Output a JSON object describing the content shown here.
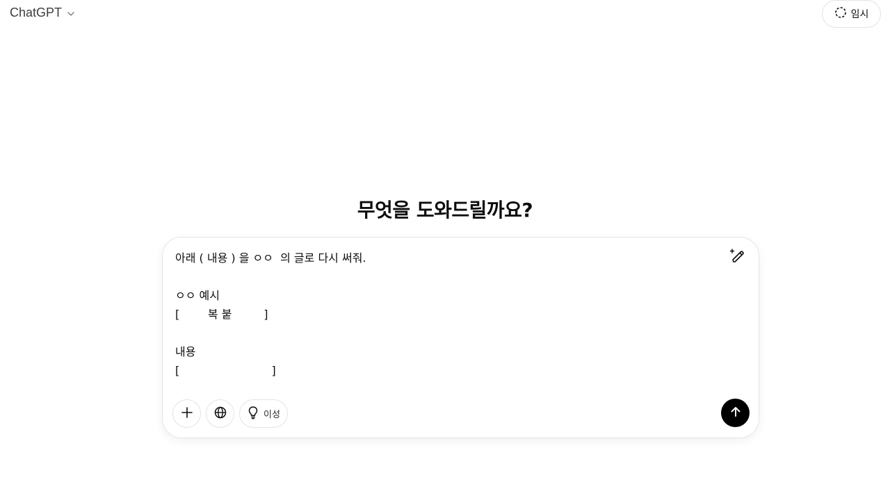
{
  "header": {
    "model_name": "ChatGPT",
    "temporary_label": "임시"
  },
  "main": {
    "headline": "무엇을 도와드릴까요?"
  },
  "composer": {
    "text": "아래 ( 내용 ) 을 ㅇㅇ  의 글로 다시 써줘.\n\nㅇㅇ 예시\n[        복 붙         ]\n\n내용\n[                          ]",
    "reasoning_label": "이성"
  },
  "icons": {
    "model_chevron": "chevron-down-icon",
    "temporary": "dashed-circle-icon",
    "edit": "magic-pencil-icon",
    "attach": "plus-icon",
    "search": "globe-icon",
    "reason": "lightbulb-icon",
    "send": "arrow-up-icon"
  }
}
